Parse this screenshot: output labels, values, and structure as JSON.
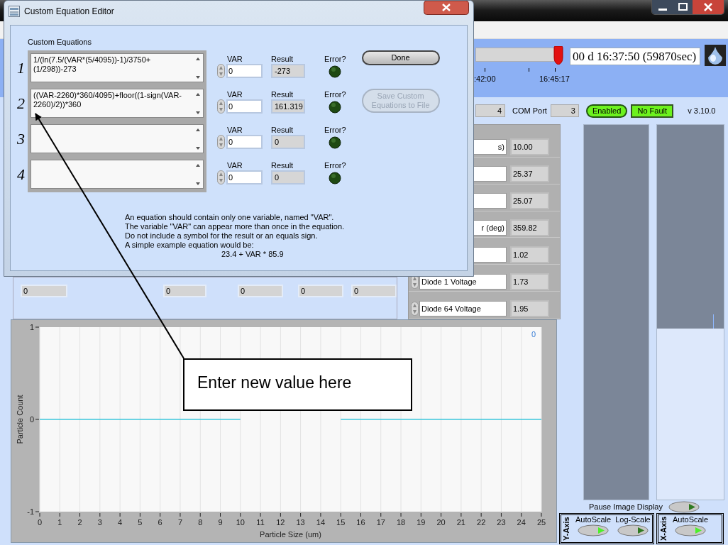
{
  "app": {
    "timeline": {
      "level": 0.94,
      "tick_labels": [
        ":42:00",
        "16:45:17"
      ],
      "elapsed": "00 d 16:37:50 (59870sec)"
    },
    "status": {
      "field": "4",
      "com_port_label": "COM Port",
      "com_port": "3",
      "enabled": {
        "label": "Enabled",
        "on": true
      },
      "fault": {
        "label": "No Fault",
        "ok": true
      },
      "version": "v 3.10.0"
    },
    "readings": [
      {
        "kind": "covered",
        "label": "s)",
        "value": "10.00"
      },
      {
        "kind": "covered",
        "value": "25.37"
      },
      {
        "kind": "covered",
        "value": "25.07"
      },
      {
        "kind": "covered",
        "label": "r (deg)",
        "value": "359.82"
      },
      {
        "kind": "covered",
        "value": "1.02"
      },
      {
        "kind": "full",
        "label": "Diode 1 Voltage",
        "value": "1.73"
      },
      {
        "kind": "full",
        "label": "Diode 64 Voltage",
        "value": "1.95"
      }
    ],
    "value_fields": [
      "0",
      "0",
      "0",
      "0",
      "0"
    ],
    "chart": {
      "plot_value": "0",
      "chart_data": {
        "type": "line",
        "xlabel": "Particle Size (um)",
        "ylabel": "Particle Count",
        "x": [
          0,
          1,
          2,
          3,
          4,
          5,
          6,
          7,
          8,
          9,
          10,
          11,
          12,
          13,
          14,
          15,
          16,
          17,
          18,
          19,
          20,
          21,
          22,
          23,
          24,
          25
        ],
        "series": [
          {
            "color": "#3cc6dc",
            "values": [
              0,
              0,
              0,
              0,
              0,
              0,
              0,
              0,
              0,
              0,
              0,
              null,
              null,
              null,
              null,
              0,
              0,
              0,
              0,
              0,
              0,
              0,
              0,
              0,
              0,
              0
            ]
          }
        ],
        "xlim": [
          0,
          25
        ],
        "ylim": [
          -1,
          1
        ],
        "xticks": [
          0,
          1,
          2,
          3,
          4,
          5,
          6,
          7,
          8,
          9,
          10,
          11,
          12,
          13,
          14,
          15,
          16,
          17,
          18,
          19,
          20,
          21,
          22,
          23,
          24,
          25
        ],
        "yticks": [
          -1,
          0,
          1
        ],
        "grid": true
      }
    },
    "pause_image_display": {
      "label": "Pause Image Display",
      "on": false
    },
    "y_axis": {
      "label": "Y-Axis",
      "toggles": [
        {
          "label": "AutoScale",
          "on": true
        },
        {
          "label": "Log-Scale",
          "on": false
        }
      ]
    },
    "x_axis": {
      "label": "X-Axis",
      "toggles": [
        {
          "label": "AutoScale",
          "on": true
        }
      ]
    }
  },
  "dialog": {
    "title": "Custom Equation Editor",
    "section_label": "Custom Equations",
    "equations": [
      {
        "number": "1",
        "text": "1/(ln(7.5/(VAR*(5/4095))-1)/3750+(1/298))-273",
        "var_label": "VAR",
        "var": "0",
        "result_label": "Result",
        "result": "-273",
        "error_label": "Error?",
        "error": false
      },
      {
        "number": "2",
        "text": "((VAR-2260)*360/4095)+floor((1-sign(VAR-2260)/2))*360",
        "var_label": "VAR",
        "var": "0",
        "result_label": "Result",
        "result": "161.319",
        "error_label": "Error?",
        "error": false
      },
      {
        "number": "3",
        "var_label": "VAR",
        "var": "0",
        "result_label": "Result",
        "result": "0",
        "error_label": "Error?",
        "error": false
      },
      {
        "number": "4",
        "var_label": "VAR",
        "var": "0",
        "result_label": "Result",
        "result": "0",
        "error_label": "Error?",
        "error": false
      }
    ],
    "buttons": [
      {
        "label": "Done",
        "disabled": false
      },
      {
        "label": "Save Custom Equations to File",
        "disabled": true
      }
    ],
    "help_lines": [
      "An equation should contain only one variable, named \"VAR\".",
      "The variable \"VAR\" can appear more than once in the equation.",
      "Do not include a symbol for the result or an equals sign.",
      "A simple example equation would be:"
    ],
    "example": "23.4 + VAR * 85.9"
  },
  "annotation": {
    "text": "Enter new value here"
  }
}
